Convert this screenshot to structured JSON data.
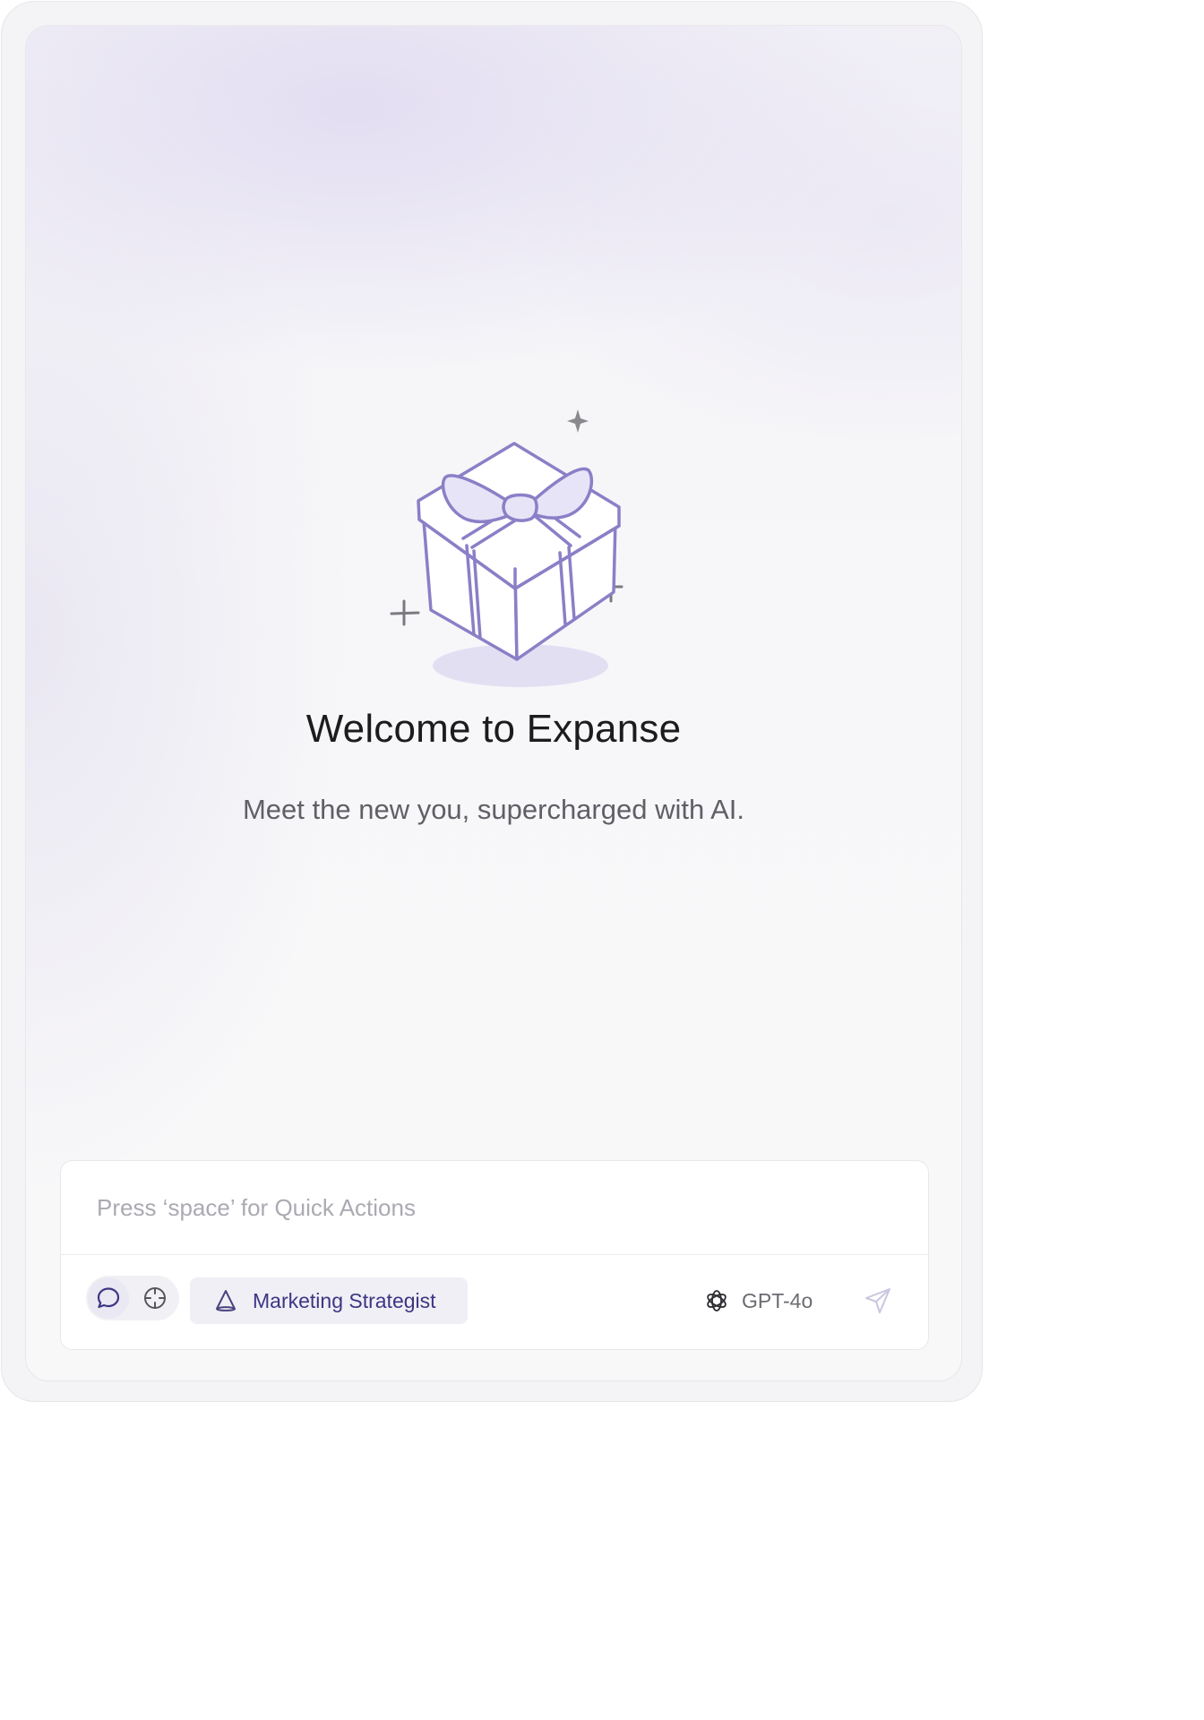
{
  "welcome": {
    "title": "Welcome to Expanse",
    "subtitle": "Meet the new you, supercharged with AI."
  },
  "composer": {
    "placeholder": "Press ‘space’ for Quick Actions",
    "modes": [
      {
        "icon": "chat-bubble-icon",
        "active": true
      },
      {
        "icon": "crosshair-icon",
        "active": false
      }
    ],
    "persona": {
      "icon": "cone-icon",
      "label": "Marketing Strategist"
    },
    "model": {
      "icon": "openai-logo-icon",
      "label": "GPT-4o"
    },
    "send_icon": "send-icon"
  },
  "illustration": {
    "icon": "gift-box-icon"
  },
  "colors": {
    "accent": "#3d3584",
    "illustration_stroke": "#8b7fc7",
    "ribbon_fill": "#e6e2f6",
    "title": "#1c1c1f",
    "subtitle": "#5f5f66",
    "placeholder": "#aaaab2"
  }
}
